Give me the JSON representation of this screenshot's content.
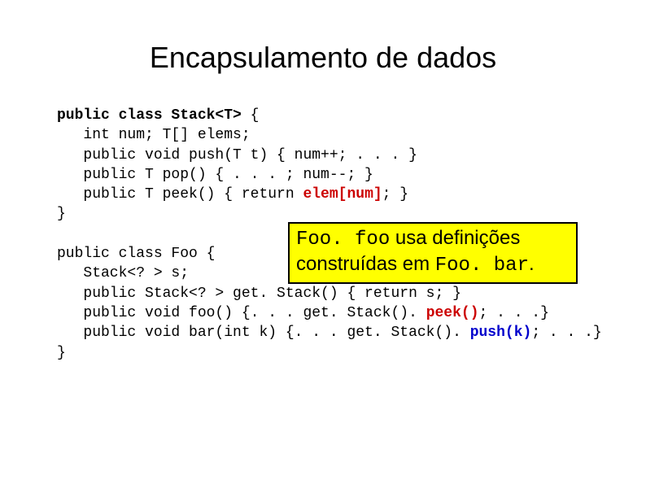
{
  "title": "Encapsulamento de dados",
  "code1_l1a": "public class Stack<T>",
  "code1_l1b": " {",
  "code1_l2": "   int num; T[] elems;",
  "code1_l3": "   public void push(T t) { num++; . . . }",
  "code1_l4": "   public T pop() { . . . ; num--; }",
  "code1_l5a": "   public T peek() { return ",
  "code1_l5b": "elem[num]",
  "code1_l5c": "; }",
  "code1_l6": "}",
  "code2_l1": "public class Foo {",
  "code2_l2": "   Stack<? > s;",
  "code2_l3": "   public Stack<? > get. Stack() { return s; }",
  "code2_l4a": "   public void foo() {. . . get. Stack(). ",
  "code2_l4b": "peek()",
  "code2_l4c": "; . . .}",
  "code2_l5a": "   public void bar(int k) {. . . get. Stack(). ",
  "code2_l5b": "push(k)",
  "code2_l5c": "; . . .}",
  "code2_l6": "}",
  "callout_mono1": "Foo. foo",
  "callout_text1": " usa definições construídas em ",
  "callout_mono2": "Foo. bar",
  "callout_text2": "."
}
